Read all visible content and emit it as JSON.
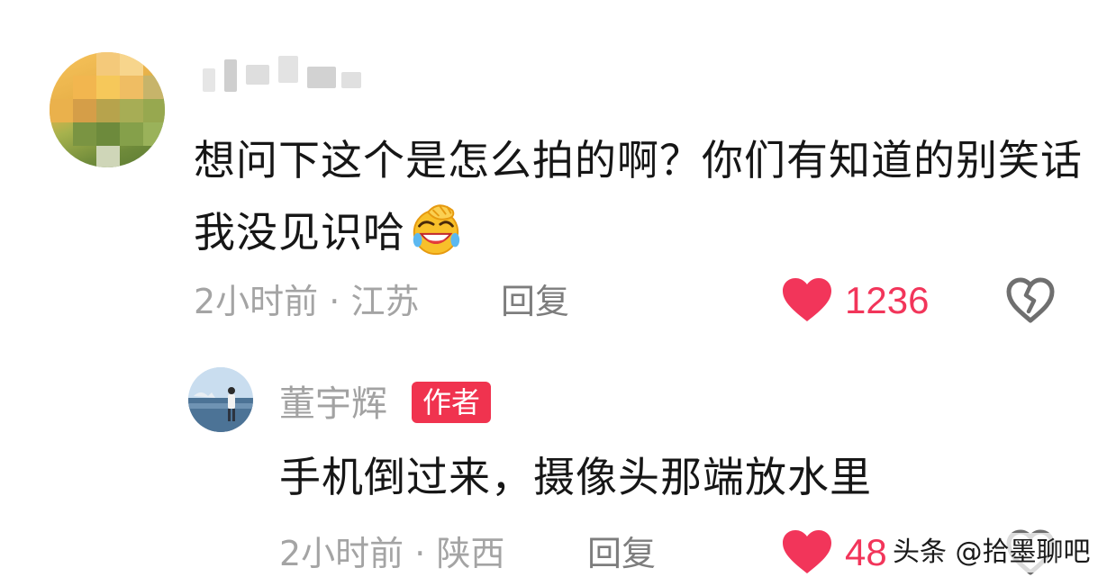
{
  "comment": {
    "text": "想问下这个是怎么拍的啊？你们有知道的别笑话我没见识哈",
    "emoji": "facepalm-laugh-emoji",
    "time": "2小时前",
    "separator": "·",
    "location": "江苏",
    "reply_label": "回复",
    "likes": "1236"
  },
  "reply": {
    "author": "董宇辉",
    "badge": "作者",
    "text": "手机倒过来，摄像头那端放水里",
    "time": "2小时前",
    "separator": "·",
    "location": "陕西",
    "reply_label": "回复",
    "likes": "48"
  },
  "watermark": "头条 @拾墨聊吧",
  "colors": {
    "like": "#f2355a",
    "badge": "#f0334f",
    "meta": "#a4a4a4",
    "text": "#161616"
  },
  "icons": {
    "like": "heart-icon",
    "dislike": "broken-heart-icon"
  }
}
